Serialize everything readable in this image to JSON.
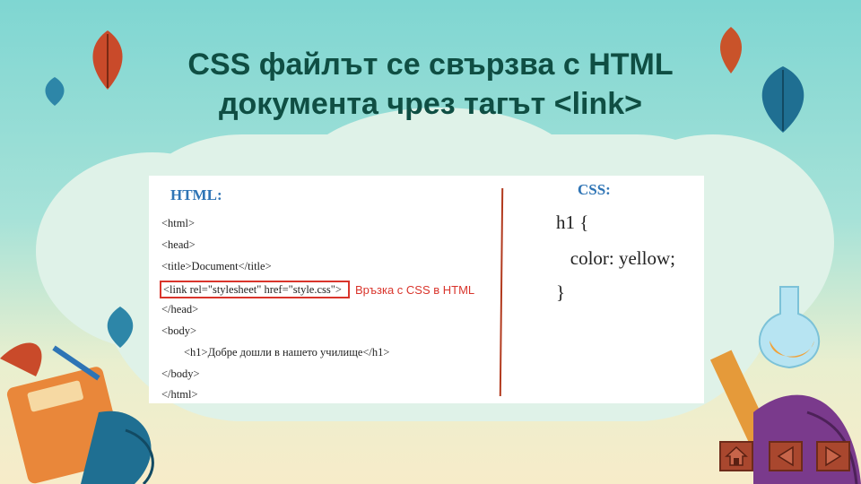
{
  "slide": {
    "title_line1": "CSS файлът  се свързва с HTML",
    "title_line2": "документа чрез тагът <link>"
  },
  "html_panel": {
    "label": "HTML:",
    "lines": [
      "<html>",
      "<head>",
      "<title>Document</title>",
      "<link rel=\"stylesheet\" href=\"style.css\">",
      "</head>",
      "<body>",
      "        <h1>Добре дошли в нашето училище</h1>",
      "</body>",
      "</html>"
    ],
    "note": "Връзка с CSS в HTML"
  },
  "css_panel": {
    "label": "CSS:",
    "lines": [
      "h1 {",
      "   color: yellow;",
      "}"
    ]
  },
  "nav": {
    "home_icon": "home-icon",
    "prev_icon": "arrow-left-icon",
    "next_icon": "arrow-right-icon"
  },
  "colors": {
    "title": "#0f4e43",
    "label": "#2e74b5",
    "accent_red": "#d9342b",
    "nav_button": "#a9472e"
  }
}
